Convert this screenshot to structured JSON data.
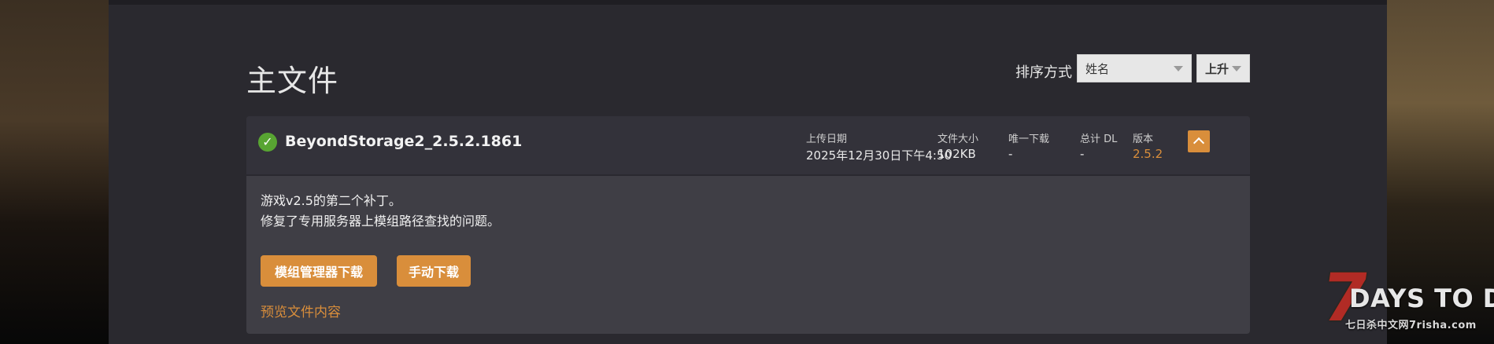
{
  "section": {
    "title": "主文件"
  },
  "sort": {
    "label": "排序方式",
    "by_value": "姓名",
    "order_value": "上升"
  },
  "file": {
    "status_icon": "check-circle-icon",
    "name": "BeyondStorage2_2.5.2.1861",
    "meta": {
      "upload_date_label": "上传日期",
      "upload_date_value": "2025年12月30日下午4:50",
      "size_label": "文件大小",
      "size_value": "102KB",
      "unique_dl_label": "唯一下载",
      "unique_dl_value": "-",
      "total_dl_label": "总计 DL",
      "total_dl_value": "-",
      "version_label": "版本",
      "version_value": "2.5.2"
    },
    "description_lines": [
      "游戏v2.5的第二个补丁。",
      "修复了专用服务器上模组路径查找的问题。"
    ],
    "buttons": {
      "mod_manager_download": "模组管理器下载",
      "manual_download": "手动下载"
    },
    "preview_link": "预览文件内容"
  },
  "watermark": {
    "seven": "7",
    "title": "DAYS TO DIE",
    "subtitle": "七日杀中文网7risha.com"
  },
  "colors": {
    "accent": "#d98e3b",
    "panel": "#3f3e45",
    "header": "#33323a",
    "page": "#2a292f",
    "success": "#58a532"
  }
}
